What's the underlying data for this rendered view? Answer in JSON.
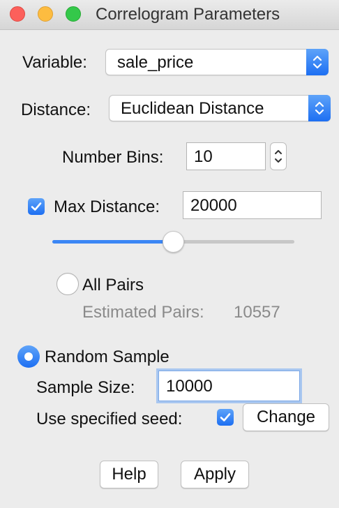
{
  "window": {
    "title": "Correlogram Parameters",
    "traffic_lights": [
      {
        "name": "close",
        "color": "#fc605b"
      },
      {
        "name": "minimize",
        "color": "#fdbc40"
      },
      {
        "name": "zoom",
        "color": "#34c84a"
      }
    ]
  },
  "variable": {
    "label": "Variable:",
    "selected": "sale_price",
    "icon": "chevron-updown-icon"
  },
  "distance": {
    "label": "Distance:",
    "selected": "Euclidean Distance",
    "icon": "chevron-updown-icon"
  },
  "bins": {
    "label": "Number Bins:",
    "value": "10",
    "icon": "stepper-icon"
  },
  "max_distance": {
    "label": "Max Distance:",
    "checked": true,
    "value": "20000",
    "slider_fraction": 0.5
  },
  "all_pairs": {
    "label": "All Pairs",
    "selected": false,
    "estimated_label": "Estimated Pairs:",
    "estimated_value": "10557"
  },
  "random_sample": {
    "label": "Random Sample",
    "selected": true,
    "size_label": "Sample Size:",
    "size_value": "10000"
  },
  "seed": {
    "label": "Use specified seed:",
    "checked": true,
    "change_label": "Change"
  },
  "buttons": {
    "help": "Help",
    "apply": "Apply"
  },
  "colors": {
    "accent": "#2f7cf6",
    "background": "#ececec"
  }
}
